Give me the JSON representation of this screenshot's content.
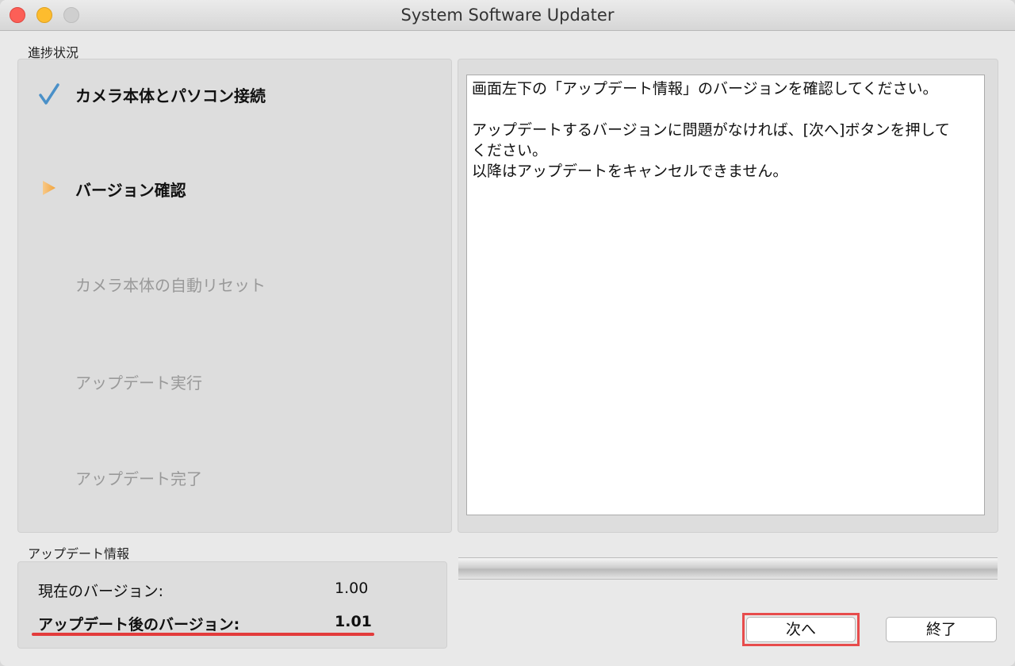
{
  "window": {
    "title": "System Software Updater"
  },
  "progress": {
    "label": "進捗状況",
    "steps": [
      {
        "label": "カメラ本体とパソコン接続",
        "state": "done",
        "icon": "checkmark-icon"
      },
      {
        "label": "バージョン確認",
        "state": "active",
        "icon": "play-arrow-icon"
      },
      {
        "label": "カメラ本体の自動リセット",
        "state": "pending"
      },
      {
        "label": "アップデート実行",
        "state": "pending"
      },
      {
        "label": "アップデート完了",
        "state": "pending"
      }
    ]
  },
  "message": {
    "text": "画面左下の「アップデート情報」のバージョンを確認してください。\n\nアップデートするバージョンに問題がなければ、[次へ]ボタンを押して\nください。\n以降はアップデートをキャンセルできません。"
  },
  "update_info": {
    "label": "アップデート情報",
    "current_label": "現在のバージョン:",
    "current_value": "1.00",
    "after_label": "アップデート後のバージョン:",
    "after_value": "1.01"
  },
  "buttons": {
    "next_label": "次へ",
    "quit_label": "終了"
  },
  "colors": {
    "highlight_red": "#e74c4c",
    "check_blue": "#4a90c8",
    "arrow_orange": "#f2a33a"
  }
}
